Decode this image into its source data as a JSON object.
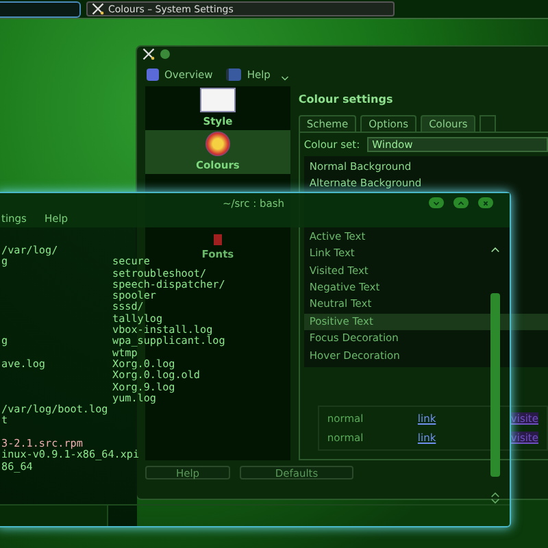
{
  "taskbar": {
    "tasks": [
      {
        "title": "Colours – System Settings"
      }
    ]
  },
  "settings_window": {
    "toolbar": [
      {
        "label": "Overview"
      },
      {
        "label": "Help"
      }
    ],
    "sidebar": [
      {
        "label": "Style",
        "selected": false
      },
      {
        "label": "Colours",
        "selected": true
      },
      {
        "label": "Fonts",
        "selected": false
      }
    ],
    "heading": "Colour settings",
    "tabs": [
      {
        "label": "Scheme",
        "selected": false
      },
      {
        "label": "Options",
        "selected": false
      },
      {
        "label": "Colours",
        "selected": true
      }
    ],
    "colour_set": {
      "label": "Colour set:",
      "value": "Window"
    },
    "roles": [
      {
        "label": "Normal Background",
        "selected": false
      },
      {
        "label": "Alternate Background",
        "selected": false
      },
      {
        "label": "Active Text",
        "selected": false
      },
      {
        "label": "Link Text",
        "selected": false
      },
      {
        "label": "Visited Text",
        "selected": false
      },
      {
        "label": "Negative Text",
        "selected": false
      },
      {
        "label": "Neutral Text",
        "selected": false
      },
      {
        "label": "Positive Text",
        "selected": true
      },
      {
        "label": "Focus Decoration",
        "selected": false
      },
      {
        "label": "Hover Decoration",
        "selected": false
      }
    ],
    "preview_rows": [
      {
        "column_1": "normal",
        "column_2": "link",
        "column_3": "visite"
      },
      {
        "column_1": "normal",
        "column_2": "link",
        "column_3": "visite"
      }
    ],
    "buttons": [
      "Help",
      "Defaults"
    ]
  },
  "terminal": {
    "title": "~/src : bash",
    "menu": [
      "tings",
      "Help"
    ],
    "lines": [
      {
        "left": "/var/log/",
        "kind": "plain"
      },
      {
        "left": "g",
        "right": "secure",
        "kind": "plain"
      },
      {
        "right": "setroubleshoot/",
        "kind": "plain"
      },
      {
        "right": "speech-dispatcher/",
        "kind": "plain"
      },
      {
        "right": "spooler",
        "kind": "plain"
      },
      {
        "right": "sssd/",
        "kind": "plain"
      },
      {
        "right": "tallylog",
        "kind": "plain"
      },
      {
        "right": "vbox-install.log",
        "kind": "plain"
      },
      {
        "left": "g",
        "right": "wpa_supplicant.log",
        "kind": "plain"
      },
      {
        "right": "wtmp",
        "kind": "plain"
      },
      {
        "left": "ave.log",
        "right": "Xorg.0.log",
        "kind": "plain"
      },
      {
        "right": "Xorg.0.log.old",
        "kind": "plain"
      },
      {
        "right": "Xorg.9.log",
        "kind": "plain"
      },
      {
        "right": "yum.log",
        "kind": "plain"
      },
      {
        "left": "/var/log/boot.log",
        "kind": "plain"
      },
      {
        "left": "t",
        "kind": "plain"
      },
      {
        "kind": "blank"
      },
      {
        "left": "3-2.1.src.rpm",
        "kind": "package"
      },
      {
        "left": "inux-v0.9.1-x86_64.xpi",
        "kind": "plain"
      },
      {
        "left": "86_64",
        "kind": "plain"
      }
    ]
  }
}
